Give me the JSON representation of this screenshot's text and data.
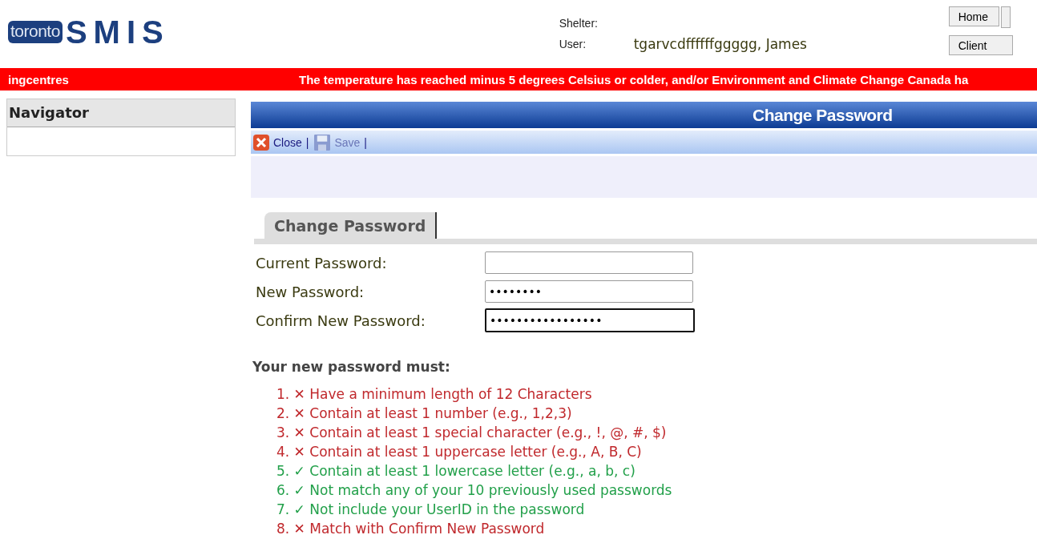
{
  "logo": {
    "badge": "toronto",
    "name": "SMIS"
  },
  "header": {
    "shelter_label": "Shelter:",
    "user_label": "User:",
    "user_value": "tgarvcdffffffggggg, James",
    "buttons": [
      "Home",
      "Client"
    ]
  },
  "banner": {
    "left_text": "ingcentres",
    "right_text": "The temperature has reached minus 5 degrees Celsius or colder, and/or Environment and Climate Change Canada ha"
  },
  "navigator": {
    "title": "Navigator"
  },
  "panel": {
    "title": "Change Password",
    "toolbar": [
      {
        "label": "Close",
        "kind": "close",
        "disabled": false
      },
      {
        "label": "Save",
        "kind": "save",
        "disabled": true
      }
    ],
    "separator": "|"
  },
  "tabs": [
    {
      "label": "Change Password",
      "selected": true
    }
  ],
  "fields": [
    {
      "label": "Current Password:",
      "focused": false
    },
    {
      "label": "New Password:",
      "masked": "••••••••",
      "focused": false
    },
    {
      "label": "Confirm New Password:",
      "masked": "•••••••••••••••••",
      "focused": true
    }
  ],
  "rules_heading": "Your new password must:",
  "rules": [
    {
      "number": "1.",
      "mark": "✕",
      "text": "Have a minimum length of 12 Characters",
      "met": false
    },
    {
      "number": "2.",
      "mark": "✕",
      "text": "Contain at least 1 number (e.g., 1,2,3)",
      "met": false
    },
    {
      "number": "3.",
      "mark": "✕",
      "text": "Contain at least 1 special character (e.g., !, @, #, $)",
      "met": false
    },
    {
      "number": "4.",
      "mark": "✕",
      "text": "Contain at least 1 uppercase letter (e.g., A, B, C)",
      "met": false
    },
    {
      "number": "5.",
      "mark": "✓",
      "text": "Contain at least 1 lowercase letter (e.g., a, b, c)",
      "met": true
    },
    {
      "number": "6.",
      "mark": "✓",
      "text": "Not match any of your 10 previously used passwords",
      "met": true
    },
    {
      "number": "7.",
      "mark": "✓",
      "text": "Not include your UserID in the password",
      "met": true
    },
    {
      "number": "8.",
      "mark": "✕",
      "text": "Match with Confirm New Password",
      "met": false
    }
  ]
}
